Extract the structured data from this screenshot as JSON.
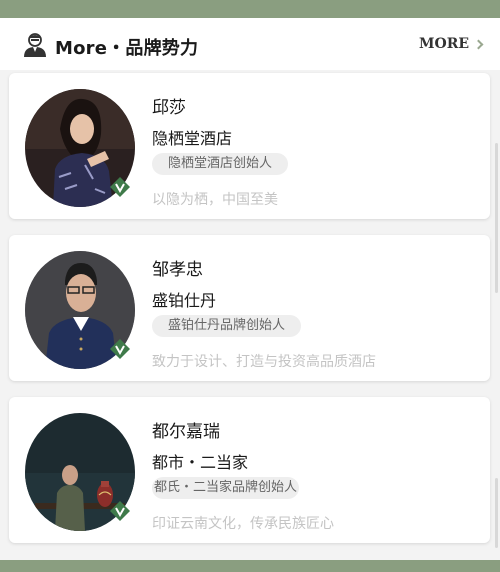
{
  "header": {
    "title": "More・品牌势力",
    "more_label": "MORE",
    "icon": "user-icon"
  },
  "cards": [
    {
      "name": "邱莎",
      "company": "隐栖堂酒店",
      "role": "隐栖堂酒店创始人",
      "motto": "以隐为栖，中国至美",
      "badge_icon": "verified-v-icon"
    },
    {
      "name": "邹孝忠",
      "company": "盛铂仕丹",
      "role": "盛铂仕丹品牌创始人",
      "motto": "致力于设计、打造与投资高品质酒店",
      "badge_icon": "verified-v-icon"
    },
    {
      "name": "都尔嘉瑞",
      "company": "都市・二当家",
      "role": "都氏・二当家品牌创始人",
      "motto": "印证云南文化，传承民族匠心",
      "badge_icon": "verified-v-icon"
    }
  ],
  "colors": {
    "accent_green": "#3f7a4a",
    "frame_green": "#8a9e80",
    "badge_bg": "#eeeeee",
    "motto_gray": "#c4c4c4"
  }
}
